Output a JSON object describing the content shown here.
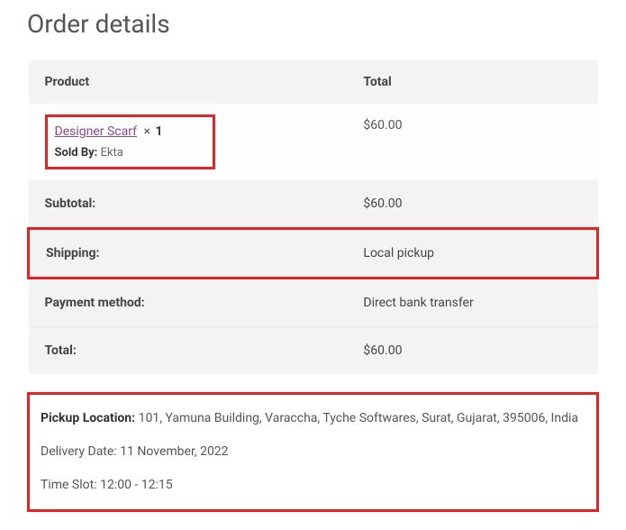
{
  "title": "Order details",
  "table": {
    "headers": {
      "product": "Product",
      "total": "Total"
    },
    "product": {
      "name": "Designer Scarf",
      "qty_sep": "×",
      "qty": "1",
      "sold_by_label": "Sold By:",
      "sold_by_vendor": "Ekta",
      "line_total": "$60.00"
    },
    "footer": {
      "subtotal_label": "Subtotal:",
      "subtotal_value": "$60.00",
      "shipping_label": "Shipping:",
      "shipping_value": "Local pickup",
      "payment_label": "Payment method:",
      "payment_value": "Direct bank transfer",
      "total_label": "Total:",
      "total_value": "$60.00"
    }
  },
  "pickup": {
    "location_label": "Pickup Location:",
    "location_value": "101, Yamuna Building, Varaccha, Tyche Softwares, Surat, Gujarat, 395006, India",
    "delivery_label": "Delivery Date:",
    "delivery_value": "11 November, 2022",
    "timeslot_label": "Time Slot:",
    "timeslot_value": "12:00 - 12:15"
  }
}
